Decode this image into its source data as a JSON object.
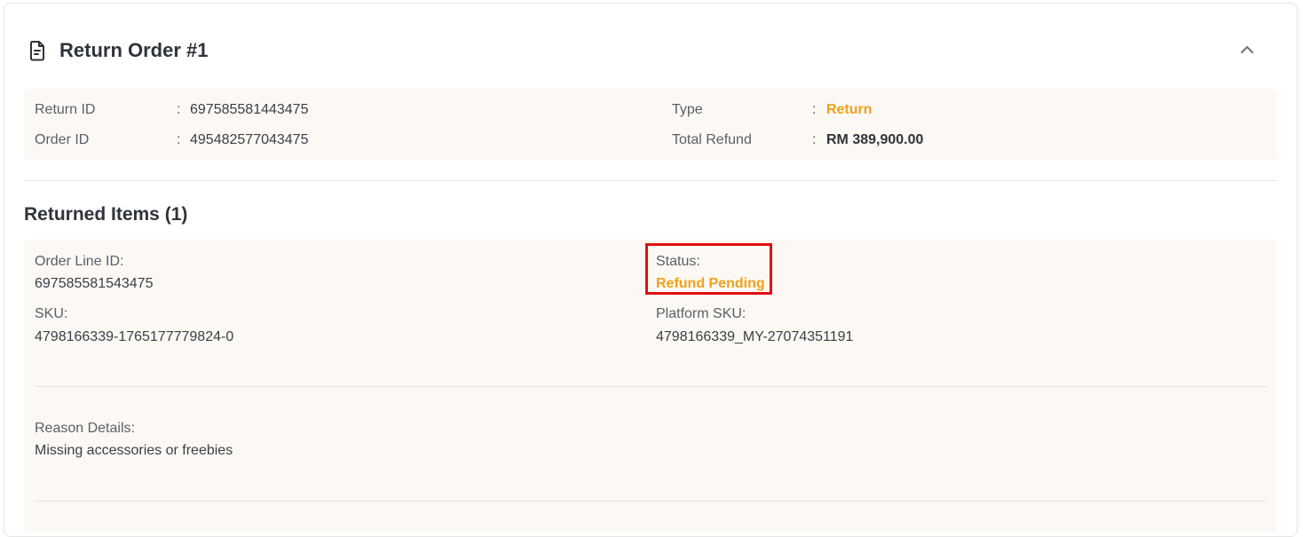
{
  "header": {
    "title": "Return Order #1",
    "doc_icon": "document-icon",
    "collapse_icon": "chevron-up-icon"
  },
  "summary": {
    "return_id_label": "Return ID",
    "return_id_value": "697585581443475",
    "order_id_label": "Order ID",
    "order_id_value": "495482577043475",
    "type_label": "Type",
    "type_value": "Return",
    "total_refund_label": "Total Refund",
    "total_refund_value": "RM 389,900.00",
    "separator": ":"
  },
  "returned_items": {
    "title": "Returned Items (1)",
    "items": [
      {
        "order_line_id_label": "Order Line ID:",
        "order_line_id_value": "697585581543475",
        "status_label": "Status:",
        "status_value": "Refund Pending",
        "sku_label": "SKU:",
        "sku_value": "4798166339-1765177779824-0",
        "platform_sku_label": "Platform SKU:",
        "platform_sku_value": "4798166339_MY-27074351191",
        "reason_label": "Reason Details:",
        "reason_value": "Missing accessories or freebies"
      }
    ]
  },
  "colors": {
    "accent": "#f0a21a",
    "panel_bg": "#fcf8f4",
    "highlight_border": "#e01010"
  }
}
